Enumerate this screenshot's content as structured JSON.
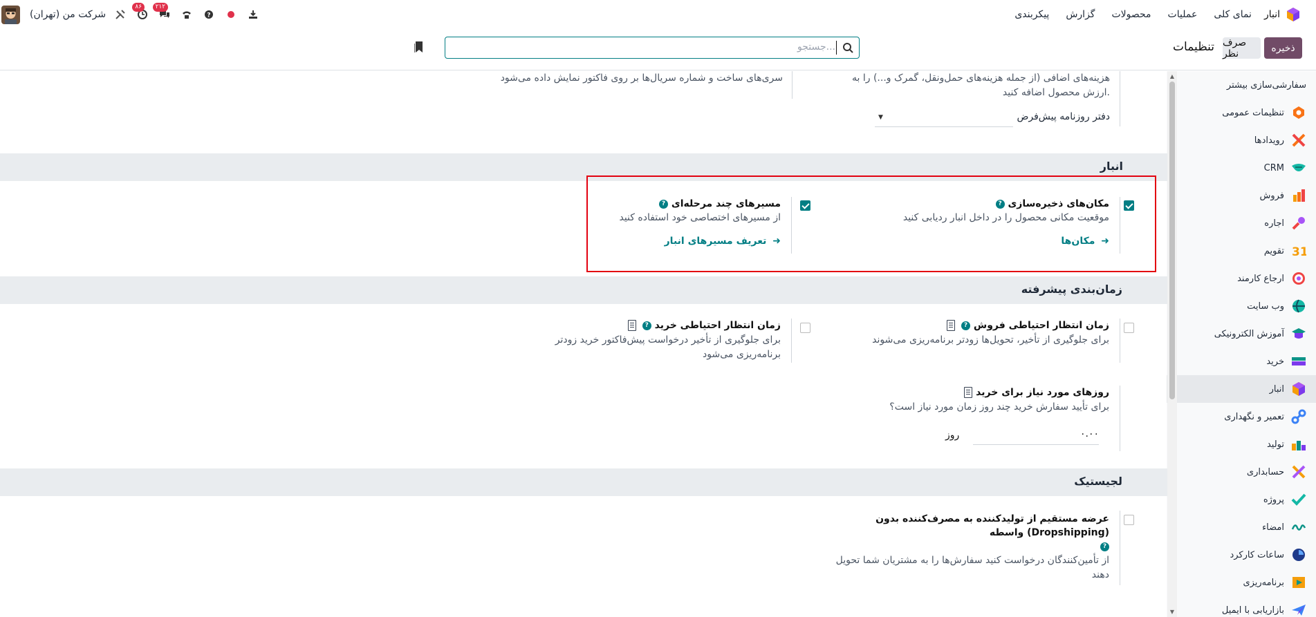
{
  "navbar": {
    "app_name": "انبار",
    "menu": [
      "نمای کلی",
      "عملیات",
      "محصولات",
      "گزارش",
      "پیکربندی"
    ],
    "company": "شرکت من (تهران)",
    "badge_chat": "۲۱۲",
    "badge_activity": "۸۶"
  },
  "control_panel": {
    "save": "ذخیره",
    "discard": "صرف نظر",
    "title": "تنظیمات",
    "search_placeholder": "جستجو..."
  },
  "sidebar": {
    "items": [
      {
        "label": "سفارشی‌سازی بیشتر",
        "icon": "none"
      },
      {
        "label": "تنظیمات عمومی",
        "icon": "settings-app-icon"
      },
      {
        "label": "رویدادها",
        "icon": "events-app-icon"
      },
      {
        "label": "CRM",
        "icon": "crm-app-icon"
      },
      {
        "label": "فروش",
        "icon": "sales-app-icon"
      },
      {
        "label": "اجاره",
        "icon": "rental-app-icon"
      },
      {
        "label": "تقویم",
        "icon": "calendar-app-icon"
      },
      {
        "label": "ارجاع کارمند",
        "icon": "referral-app-icon"
      },
      {
        "label": "وب سایت",
        "icon": "website-app-icon"
      },
      {
        "label": "آموزش الکترونیکی",
        "icon": "elearning-app-icon"
      },
      {
        "label": "خرید",
        "icon": "purchase-app-icon"
      },
      {
        "label": "انبار",
        "icon": "inventory-app-icon",
        "active": true
      },
      {
        "label": "تعمیر و نگهداری",
        "icon": "maintenance-app-icon"
      },
      {
        "label": "تولید",
        "icon": "manufacturing-app-icon"
      },
      {
        "label": "حسابداری",
        "icon": "accounting-app-icon"
      },
      {
        "label": "پروژه",
        "icon": "project-app-icon"
      },
      {
        "label": "امضاء",
        "icon": "sign-app-icon"
      },
      {
        "label": "ساعات کارکرد",
        "icon": "timesheet-app-icon"
      },
      {
        "label": "برنامه‌ریزی",
        "icon": "planning-app-icon"
      },
      {
        "label": "بازاریابی با ایمیل",
        "icon": "email-marketing-app-icon"
      }
    ]
  },
  "top_partial": {
    "landed_costs_desc": "هزینه‌های اضافی (از جمله هزینه‌های حمل‌ونقل، گمرک و...) را به ارزش محصول اضافه کنید.",
    "journal_label": "دفتر روزنامه پیش‌فرض",
    "lots_desc": "سری‌های ساخت و شماره سریال‌ها بر روی فاکتور نمایش داده می‌شود"
  },
  "warehouse": {
    "title": "انبار",
    "locations": {
      "title": "مکان‌های ذخیره‌سازی",
      "desc": "موقعیت مکانی محصول را در داخل انبار ردیابی کنید",
      "link": "مکان‌ها",
      "checked": true
    },
    "routes": {
      "title": "مسیرهای چند مرحله‌ای",
      "desc": "از مسیرهای اختصاصی خود استفاده کنید",
      "link": "تعریف مسیرهای انبار",
      "checked": true
    }
  },
  "scheduling": {
    "title": "زمان‌بندی پیشرفته",
    "sales_margin": {
      "title": "زمان انتظار احتیاطی فروش",
      "desc": "برای جلوگیری از تأخیر، تحویل‌ها زودتر برنامه‌ریزی می‌شوند",
      "checked": false
    },
    "purchase_margin": {
      "title": "زمان انتظار احتیاطی خرید",
      "desc": "برای جلوگیری از تأخیر درخواست پیش‌فاکتور خرید زودتر برنامه‌ریزی می‌شود",
      "checked": false
    },
    "days_to_purchase": {
      "title": "روزهای مورد نیاز برای خرید",
      "desc": "برای تأیید سفارش خرید چند روز زمان مورد نیاز است؟",
      "value": "۰.۰۰",
      "unit": "روز"
    }
  },
  "logistics": {
    "title": "لجیستیک",
    "dropship": {
      "title": "عرضه مستقیم از تولیدکننده به مصرف‌کننده بدون واسطه (Dropshipping)",
      "desc": "از تأمین‌کنندگان درخواست کنید سفارش‌ها را به مشتریان شما تحویل دهند",
      "checked": false
    }
  },
  "colors": {
    "primary": "#714b67",
    "accent": "#017e84",
    "highlight": "#e3000f"
  }
}
